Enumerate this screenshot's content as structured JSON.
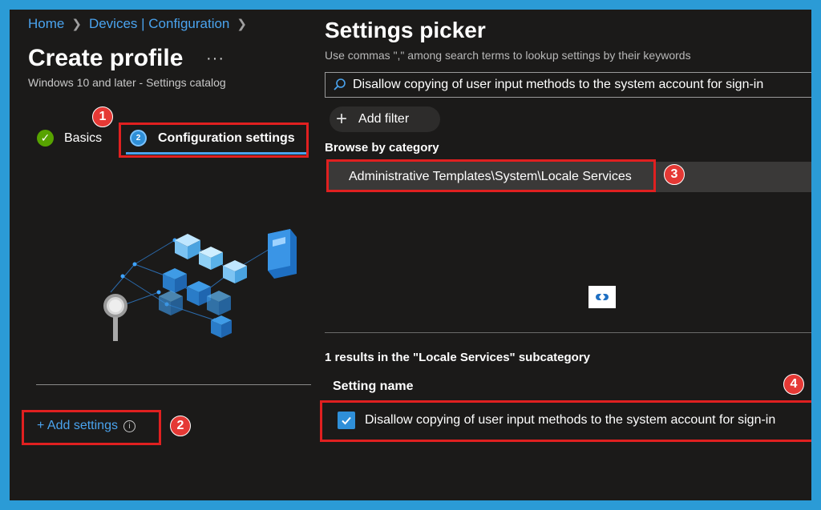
{
  "breadcrumb": {
    "home": "Home",
    "devices": "Devices | Configuration"
  },
  "page": {
    "title": "Create profile",
    "more": "···",
    "subtitle": "Windows 10 and later - Settings catalog"
  },
  "steps": [
    {
      "label": "Basics",
      "status": "completed"
    },
    {
      "label": "Configuration settings",
      "number": "2",
      "status": "current"
    }
  ],
  "add_settings": {
    "label": "+ Add settings",
    "info": "i"
  },
  "badges": [
    "1",
    "2",
    "3",
    "4"
  ],
  "picker": {
    "title": "Settings picker",
    "hint": "Use commas \",\" among search terms to lookup settings by their keywords",
    "search_value": "Disallow copying of user  input methods to the system account for sign-in",
    "add_filter": "Add filter",
    "browse_label": "Browse by category",
    "category": "Administrative Templates\\System\\Locale Services",
    "results_text": "1 results in the \"Locale Services\" subcategory",
    "column_header": "Setting name",
    "results": [
      {
        "name": "Disallow copying of user input methods to the system account for sign-in",
        "checked": true
      }
    ]
  },
  "colors": {
    "frame_border": "#2b9bd6",
    "background": "#1b1a19",
    "link": "#4aa3ee",
    "highlight_box": "#e02020",
    "badge": "#e53935",
    "check_green": "#57a300",
    "checkbox_blue": "#2f8fd8"
  }
}
